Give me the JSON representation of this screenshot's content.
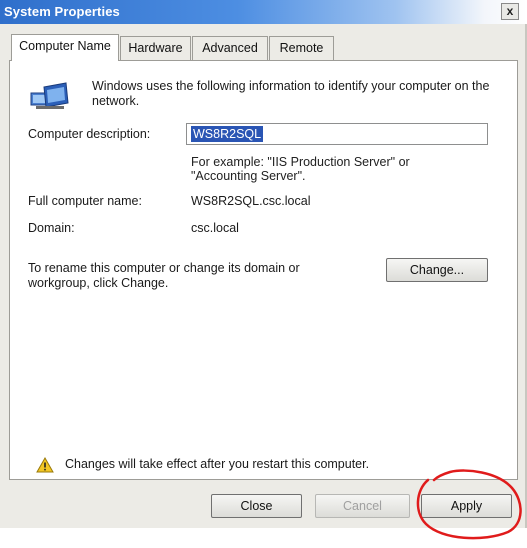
{
  "window": {
    "title": "System Properties",
    "close_glyph": "x"
  },
  "tabs": [
    {
      "label": "Computer Name",
      "active": true
    },
    {
      "label": "Hardware",
      "active": false
    },
    {
      "label": "Advanced",
      "active": false
    },
    {
      "label": "Remote",
      "active": false
    }
  ],
  "panel": {
    "intro": "Windows uses the following information to identify your computer on the network.",
    "description_label": "Computer description:",
    "description_value": "WS8R2SQL",
    "example_line1": "For example: \"IIS Production Server\" or",
    "example_line2": "\"Accounting Server\".",
    "full_name_label": "Full computer name:",
    "full_name_value": "WS8R2SQL.csc.local",
    "domain_label": "Domain:",
    "domain_value": "csc.local",
    "rename_line1": "To rename this computer or change its domain or",
    "rename_line2": "workgroup, click Change.",
    "change_label": "Change...",
    "warning_text": "Changes will take effect after you restart this computer."
  },
  "footer": {
    "close_label": "Close",
    "cancel_label": "Cancel",
    "apply_label": "Apply"
  },
  "colors": {
    "titlebar": "#2f6fcb",
    "selection": "#2a55b4",
    "annotation": "#e01b1b"
  },
  "icons": {
    "network": "network-computer-icon",
    "warning": "warning-icon"
  }
}
